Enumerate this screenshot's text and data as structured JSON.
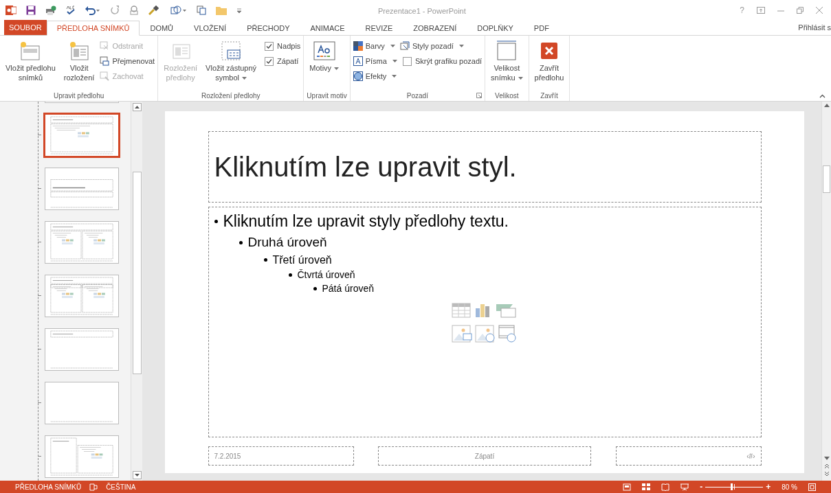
{
  "window": {
    "title": "Prezentace1 - PowerPoint",
    "help": "?"
  },
  "tabs": [
    {
      "label": "SOUBOR",
      "kind": "file",
      "selected": false
    },
    {
      "label": "PŘEDLOHA SNÍMKŮ",
      "kind": "tab",
      "selected": true
    },
    {
      "label": "DOMŮ",
      "kind": "tab",
      "selected": false
    },
    {
      "label": "VLOŽENÍ",
      "kind": "tab",
      "selected": false
    },
    {
      "label": "PŘECHODY",
      "kind": "tab",
      "selected": false
    },
    {
      "label": "ANIMACE",
      "kind": "tab",
      "selected": false
    },
    {
      "label": "REVIZE",
      "kind": "tab",
      "selected": false
    },
    {
      "label": "ZOBRAZENÍ",
      "kind": "tab",
      "selected": false
    },
    {
      "label": "DOPLŇKY",
      "kind": "tab",
      "selected": false
    },
    {
      "label": "PDF",
      "kind": "tab",
      "selected": false
    }
  ],
  "sign_in": "Přihlásit s",
  "ribbon": [
    {
      "label": "Upravit předlohu",
      "columns": [
        [
          {
            "kind": "big",
            "label": "Vložit předlohu\nsnímků",
            "disabled": false,
            "dropdown": false
          }
        ],
        [
          {
            "kind": "big",
            "label": "Vložit\nrozložení",
            "disabled": false,
            "dropdown": false
          }
        ],
        [
          {
            "kind": "small",
            "label": "Odstranit",
            "disabled": true,
            "dropdown": false
          },
          {
            "kind": "small",
            "label": "Přejmenovat",
            "disabled": false,
            "dropdown": false
          },
          {
            "kind": "small",
            "label": "Zachovat",
            "disabled": true,
            "dropdown": false
          }
        ]
      ]
    },
    {
      "label": "Rozložení předlohy",
      "columns": [
        [
          {
            "kind": "big",
            "label": "Rozložení\npředlohy",
            "disabled": true,
            "dropdown": false
          }
        ],
        [
          {
            "kind": "big",
            "label": "Vložit zástupný\nsymbol",
            "disabled": false,
            "dropdown": true
          }
        ],
        [
          {
            "kind": "check",
            "label": "Nadpis",
            "checked": true
          },
          {
            "kind": "check",
            "label": "Zápatí",
            "checked": true
          }
        ]
      ]
    },
    {
      "label": "Upravit motiv",
      "columns": [
        [
          {
            "kind": "big",
            "label": "Motivy",
            "disabled": false,
            "dropdown": true
          }
        ]
      ]
    },
    {
      "label": "Pozadí",
      "launcher": true,
      "columns": [
        [
          {
            "kind": "small",
            "label": "Barvy",
            "disabled": false,
            "dropdown": true
          },
          {
            "kind": "small",
            "label": "Písma",
            "disabled": false,
            "dropdown": true
          },
          {
            "kind": "small",
            "label": "Efekty",
            "disabled": false,
            "dropdown": true
          }
        ],
        [
          {
            "kind": "small",
            "label": "Styly pozadí",
            "disabled": false,
            "dropdown": true
          },
          {
            "kind": "check",
            "label": "Skrýt grafiku pozadí",
            "checked": false
          }
        ]
      ]
    },
    {
      "label": "Velikost",
      "columns": [
        [
          {
            "kind": "big",
            "label": "Velikost\nsnímku",
            "disabled": false,
            "dropdown": true
          }
        ]
      ]
    },
    {
      "label": "Zavřít",
      "columns": [
        [
          {
            "kind": "big",
            "label": "Zavřít\npředlohu",
            "disabled": false,
            "dropdown": false
          }
        ]
      ]
    }
  ],
  "thumbnails": [
    {
      "kind": "content",
      "selected": true
    },
    {
      "kind": "section",
      "selected": false
    },
    {
      "kind": "two",
      "selected": false
    },
    {
      "kind": "compare",
      "selected": false
    },
    {
      "kind": "title",
      "selected": false
    },
    {
      "kind": "blank",
      "selected": false
    },
    {
      "kind": "caption",
      "selected": false
    }
  ],
  "slide": {
    "title": "Kliknutím lze upravit styl.",
    "bullets": [
      {
        "text": "Kliknutím lze upravit styly předlohy textu.",
        "children": [
          {
            "text": "Druhá úroveň",
            "children": [
              {
                "text": "Třetí úroveň",
                "children": [
                  {
                    "text": "Čtvrtá úroveň",
                    "children": [
                      {
                        "text": "Pátá úroveň"
                      }
                    ]
                  }
                ]
              }
            ]
          }
        ]
      }
    ],
    "date": "7.2.2015",
    "footer": "Zápatí",
    "number": "‹#›"
  },
  "status_bar": {
    "view": "PŘEDLOHA SNÍMKŮ",
    "language": "ČEŠTINA",
    "zoom": {
      "level": 0.45,
      "reading": "80 %",
      "minus": "-",
      "plus": "+"
    }
  }
}
